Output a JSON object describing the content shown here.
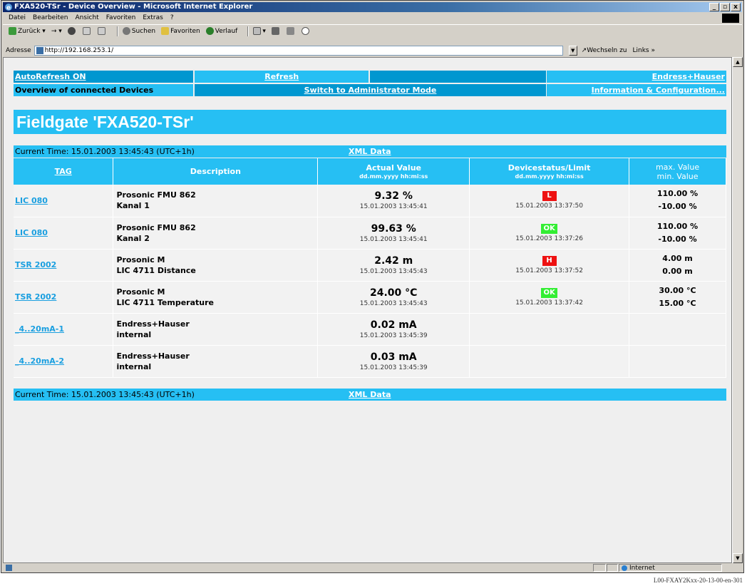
{
  "window": {
    "title": "FXA520-TSr - Device Overview - Microsoft Internet Explorer",
    "min": "_",
    "max": "3",
    "close": "x"
  },
  "menu": [
    "Datei",
    "Bearbeiten",
    "Ansicht",
    "Favoriten",
    "Extras",
    "?"
  ],
  "toolbar": {
    "back": "Zurück",
    "search": "Suchen",
    "favorites": "Favoriten",
    "history": "Verlauf"
  },
  "address": {
    "label": "Adresse",
    "url": "http://192.168.253.1/",
    "go": "Wechseln zu",
    "links": "Links"
  },
  "nav": {
    "autorefresh": "AutoRefresh ON",
    "refresh": "Refresh",
    "brand": "Endress+Hauser",
    "overview": "Overview of connected Devices",
    "admin": "Switch to Administrator Mode",
    "info": "Information & Configuration..."
  },
  "heading": "Fieldgate 'FXA520-TSr'",
  "timebar": {
    "time": "Current Time: 15.01.2003 13:45:43 (UTC+1h)",
    "xml": "XML Data"
  },
  "table": {
    "headers": {
      "tag": "TAG",
      "description": "Description",
      "actual": "Actual Value",
      "actual_sub": "dd.mm.yyyy hh:mi:ss",
      "status": "Devicestatus/Limit",
      "status_sub": "dd.mm.yyyy hh:mi:ss",
      "max": "max. Value",
      "min": "min. Value"
    },
    "rows": [
      {
        "tag": "LIC 080",
        "desc1": "Prosonic FMU 862",
        "desc2": "Kanal 1",
        "value": "9.32 %",
        "value_time": "15.01.2003 13:45:41",
        "status": "L",
        "status_color": "#ee1111",
        "status_time": "15.01.2003 13:37:50",
        "max": "110.00 %",
        "min": "-10.00 %"
      },
      {
        "tag": "LIC 080",
        "desc1": "Prosonic FMU 862",
        "desc2": "Kanal 2",
        "value": "99.63 %",
        "value_time": "15.01.2003 13:45:41",
        "status": "OK",
        "status_color": "#33ee33",
        "status_time": "15.01.2003 13:37:26",
        "max": "110.00 %",
        "min": "-10.00 %"
      },
      {
        "tag": "TSR 2002",
        "desc1": "Prosonic M",
        "desc2": "LIC 4711 Distance",
        "value": "2.42 m",
        "value_time": "15.01.2003 13:45:43",
        "status": "H",
        "status_color": "#ee1111",
        "status_time": "15.01.2003 13:37:52",
        "max": "4.00 m",
        "min": "0.00 m"
      },
      {
        "tag": "TSR 2002",
        "desc1": "Prosonic M",
        "desc2": "LIC 4711 Temperature",
        "value": "24.00 °C",
        "value_time": "15.01.2003 13:45:43",
        "status": "OK",
        "status_color": "#33ee33",
        "status_time": "15.01.2003 13:37:42",
        "max": "30.00 °C",
        "min": "15.00 °C"
      },
      {
        "tag": "_4..20mA-1",
        "desc1": "Endress+Hauser",
        "desc2": "internal",
        "value": "0.02 mA",
        "value_time": "15.01.2003 13:45:39",
        "status": "",
        "status_color": "",
        "status_time": "",
        "max": "",
        "min": ""
      },
      {
        "tag": "_4..20mA-2",
        "desc1": "Endress+Hauser",
        "desc2": "internal",
        "value": "0.03 mA",
        "value_time": "15.01.2003 13:45:39",
        "status": "",
        "status_color": "",
        "status_time": "",
        "max": "",
        "min": ""
      }
    ]
  },
  "statusbar": {
    "zone": "Internet"
  },
  "caption": "L00-FXAY2Kxx-20-13-00-en-301",
  "colors": {
    "accent": "#26bff3",
    "accent_dark": "#0097d0",
    "link": "#1a9fe0"
  }
}
